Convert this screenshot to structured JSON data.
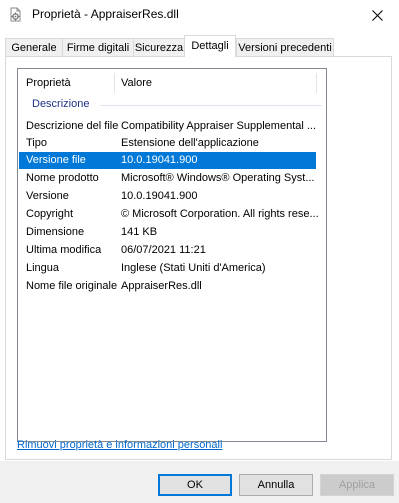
{
  "window": {
    "title": "Proprietà - AppraiserRes.dll",
    "icon": "dll-file-icon",
    "close_glyph": "✕"
  },
  "tabs": [
    {
      "label": "Generale",
      "active": false
    },
    {
      "label": "Firme digitali",
      "active": false
    },
    {
      "label": "Sicurezza",
      "active": false
    },
    {
      "label": "Dettagli",
      "active": true
    },
    {
      "label": "Versioni precedenti",
      "active": false
    }
  ],
  "details": {
    "columns": {
      "property": "Proprietà",
      "value": "Valore"
    },
    "group": "Descrizione",
    "rows": [
      {
        "property": "Descrizione del file",
        "value": "Compatibility Appraiser Supplemental ..."
      },
      {
        "property": "Tipo",
        "value": "Estensione dell'applicazione"
      },
      {
        "property": "Versione file",
        "value": "10.0.19041.900",
        "selected": true
      },
      {
        "property": "Nome prodotto",
        "value": "Microsoft® Windows® Operating Syst..."
      },
      {
        "property": "Versione",
        "value": "10.0.19041.900"
      },
      {
        "property": "Copyright",
        "value": "© Microsoft Corporation. All rights rese..."
      },
      {
        "property": "Dimensione",
        "value": "141 KB"
      },
      {
        "property": "Ultima modifica",
        "value": "06/07/2021 11:21"
      },
      {
        "property": "Lingua",
        "value": "Inglese (Stati Uniti d'America)"
      },
      {
        "property": "Nome file originale",
        "value": "AppraiserRes.dll"
      }
    ]
  },
  "remove_link": "Rimuovi proprietà e informazioni personali",
  "buttons": {
    "ok": "OK",
    "cancel": "Annulla",
    "apply": "Applica"
  },
  "colors": {
    "selection": "#0078d7",
    "group_header": "#1e3287",
    "link": "#0066cc",
    "footer_bg": "#f0f0f0"
  }
}
